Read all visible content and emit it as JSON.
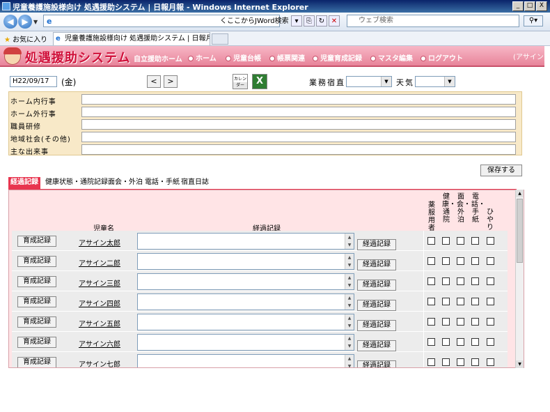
{
  "window": {
    "title": "児童養護施設様向け 処遇援助システム | 日報月報 - Windows Internet Explorer",
    "buttons": [
      "_",
      "□",
      "X"
    ]
  },
  "browser": {
    "jword_label": "くここからJWord検索",
    "search_placeholder": "ウェブ検索",
    "favorites_label": "お気に入り",
    "tab_title": "児童養護施設様向け 処遇援助システム | 日報月報"
  },
  "app": {
    "title": "処遇援助システム",
    "subtitle": "自立援助ホーム",
    "menu": [
      "ホーム",
      "児童台帳",
      "帳票関連",
      "児童育成記録",
      "マスタ編集",
      "ログアウト"
    ],
    "user": "(アサイン)"
  },
  "toolbar": {
    "date": "H22/09/17",
    "day_of_week": "(金)",
    "prev_label": "<",
    "next_label": ">",
    "calendar_label": "カレンダー",
    "excel_label": "X",
    "duty_label": "業務宿直",
    "duty_value": "",
    "weather_label": "天気",
    "weather_value": ""
  },
  "events": [
    {
      "label": "ホーム内行事",
      "value": ""
    },
    {
      "label": "ホーム外行事",
      "value": ""
    },
    {
      "label": "職員研修",
      "value": ""
    },
    {
      "label": "地域社会(その他)",
      "value": ""
    },
    {
      "label": "主な出来事",
      "value": ""
    }
  ],
  "save_label": "保存する",
  "tabs": [
    {
      "label": "経過記録",
      "active": true
    },
    {
      "label": "健康状態・通院記録",
      "active": false
    },
    {
      "label": "面会・外泊",
      "active": false
    },
    {
      "label": "電話・手紙",
      "active": false
    },
    {
      "label": "宿直日誌",
      "active": false
    }
  ],
  "table": {
    "col_child": "児童名",
    "col_record": "経過記録",
    "check_cols": [
      "薬服用者",
      "健康・通院",
      "面会・外泊",
      "電話・手紙",
      "ひやり"
    ],
    "ikusei_label": "育成記録",
    "keika_label": "経過記録",
    "rows": [
      {
        "name": "アサイン太郎"
      },
      {
        "name": "アサイン二郎"
      },
      {
        "name": "アサイン三郎"
      },
      {
        "name": "アサイン四郎"
      },
      {
        "name": "アサイン五郎"
      },
      {
        "name": "アサイン六郎"
      },
      {
        "name": "アサイン七郎"
      }
    ]
  }
}
